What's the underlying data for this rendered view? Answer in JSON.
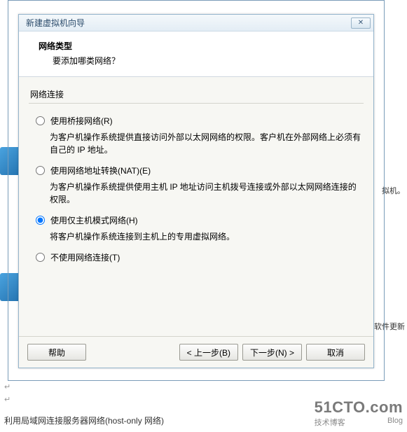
{
  "dialog": {
    "title": "新建虚拟机向导",
    "header_title": "网络类型",
    "header_sub": "要添加哪类网络？",
    "section_label": "网络连接",
    "options": [
      {
        "label": "使用桥接网络(R)",
        "desc": "为客户机操作系统提供直接访问外部以太网网络的权限。客户机在外部网络上必须有自己的 IP 地址。",
        "selected": false
      },
      {
        "label": "使用网络地址转换(NAT)(E)",
        "desc": "为客户机操作系统提供使用主机 IP 地址访问主机拨号连接或外部以太网网络连接的权限。",
        "selected": false
      },
      {
        "label": "使用仅主机模式网络(H)",
        "desc": "将客户机操作系统连接到主机上的专用虚拟网络。",
        "selected": true
      },
      {
        "label": "不使用网络连接(T)",
        "desc": "",
        "selected": false
      }
    ],
    "buttons": {
      "help": "帮助",
      "back": "< 上一步(B)",
      "next": "下一步(N) >",
      "cancel": "取消"
    }
  },
  "bg": {
    "text1": "拟机。",
    "text2": "的软件更新"
  },
  "caption": "利用局域网连接服务器网络(host-only 网络)",
  "watermark": {
    "main": "51CTO.com",
    "sub1": "技术博客",
    "sub2": "Blog"
  }
}
